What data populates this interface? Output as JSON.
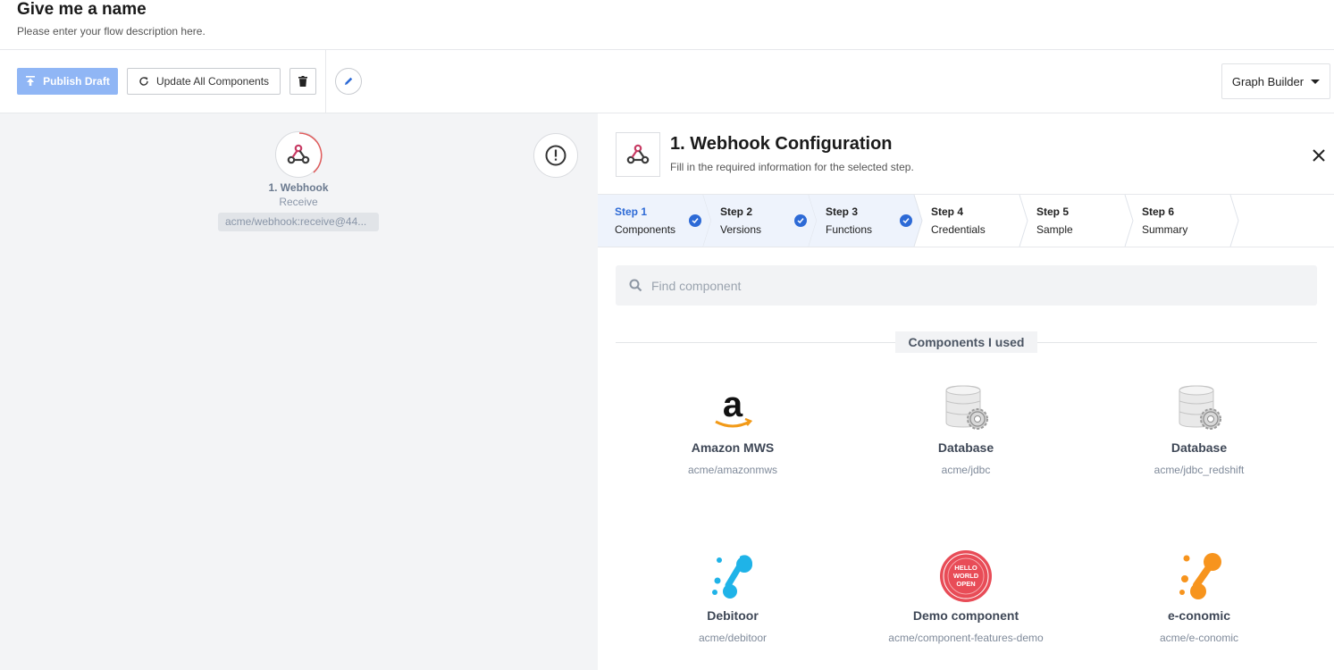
{
  "header": {
    "title": "Give me a name",
    "description": "Please enter your flow description here."
  },
  "toolbar": {
    "publish_label": "Publish Draft",
    "update_label": "Update All Components",
    "graph_builder_label": "Graph Builder"
  },
  "canvas": {
    "node": {
      "title": "1. Webhook",
      "subtitle": "Receive",
      "badge": "acme/webhook:receive@44..."
    }
  },
  "panel": {
    "title": "1. Webhook Configuration",
    "subtitle": "Fill in the required information for the selected step.",
    "steps": [
      {
        "num": "Step 1",
        "name": "Components",
        "done": true,
        "active": true
      },
      {
        "num": "Step 2",
        "name": "Versions",
        "done": true,
        "active": false
      },
      {
        "num": "Step 3",
        "name": "Functions",
        "done": true,
        "active": false
      },
      {
        "num": "Step 4",
        "name": "Credentials",
        "done": false,
        "active": false
      },
      {
        "num": "Step 5",
        "name": "Sample",
        "done": false,
        "active": false
      },
      {
        "num": "Step 6",
        "name": "Summary",
        "done": false,
        "active": false
      }
    ],
    "search": {
      "placeholder": "Find component",
      "value": ""
    },
    "section_title": "Components I used",
    "components": [
      {
        "name": "Amazon MWS",
        "id": "acme/amazonmws",
        "icon": "amazon-logo-icon"
      },
      {
        "name": "Database",
        "id": "acme/jdbc",
        "icon": "database-gear-icon"
      },
      {
        "name": "Database",
        "id": "acme/jdbc_redshift",
        "icon": "database-gear-icon"
      },
      {
        "name": "Debitoor",
        "id": "acme/debitoor",
        "icon": "debitoor-logo-icon"
      },
      {
        "name": "Demo component",
        "id": "acme/component-features-demo",
        "icon": "hello-world-open-badge-icon"
      },
      {
        "name": "e-conomic",
        "id": "acme/e-conomic",
        "icon": "e-conomic-logo-icon"
      }
    ]
  },
  "colors": {
    "primary": "#2d6ad6",
    "publish_disabled": "#90b6f5",
    "canvas_bg": "#f3f4f6",
    "step_done_bg": "#eef3fc",
    "webhook_red": "#c73a63",
    "debitoor_blue": "#1fb3e8",
    "economic_orange": "#f7941d"
  }
}
